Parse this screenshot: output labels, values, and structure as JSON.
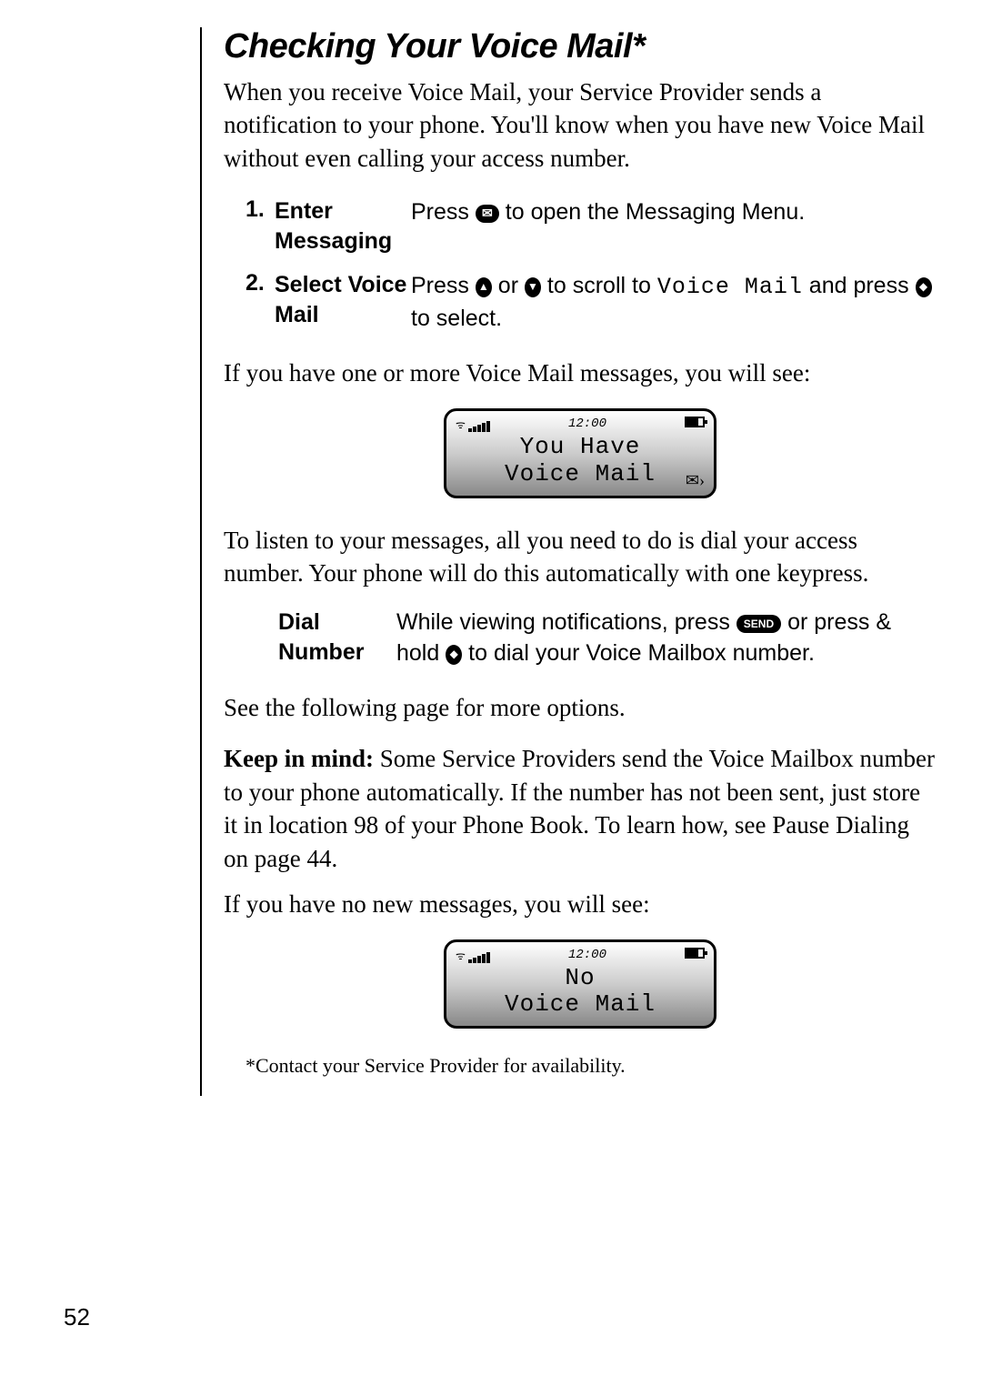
{
  "page_number": "52",
  "title": "Checking Your Voice Mail*",
  "intro": "When you receive Voice Mail, your Service Provider sends a notification to your phone. You'll know when you have new Voice Mail without even calling your access number.",
  "steps": [
    {
      "num": "1.",
      "label": "Enter Messaging",
      "desc_before": "Press ",
      "desc_after": " to open the Messaging Menu."
    },
    {
      "num": "2.",
      "label": "Select Voice Mail",
      "desc_parts": {
        "a": "Press ",
        "b": " or ",
        "c": " to scroll to ",
        "mono": "Voice Mail",
        "d": " and press ",
        "e": " to select."
      }
    }
  ],
  "after_steps": "If you have one or more Voice Mail messages, you will see:",
  "screen1": {
    "time": "12:00",
    "line1": "You Have",
    "line2": "Voice Mail"
  },
  "listen_para": "To listen to your messages, all you need to do is dial your access number. Your phone will do this automatically with one keypress.",
  "dial": {
    "label": "Dial Number",
    "a": "While viewing notifications, press ",
    "send": "SEND",
    "b": " or press & hold ",
    "c": " to dial your Voice Mailbox number."
  },
  "see_more": "See the following page for more options.",
  "keep_label": "Keep in mind:",
  "keep_text": " Some Service Providers send the Voice Mailbox number to your phone automatically. If the number has not been sent, just store it in location 98 of your Phone Book. To learn how, see Pause Dialing on page 44.",
  "no_new": "If you have no new messages, you will see:",
  "screen2": {
    "time": "12:00",
    "line1": "No",
    "line2": "Voice Mail"
  },
  "footnote": "*Contact your Service Provider for availability."
}
